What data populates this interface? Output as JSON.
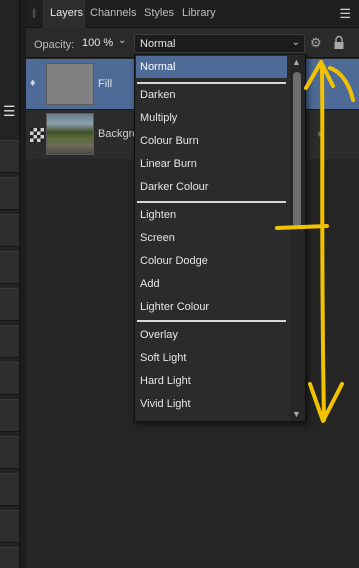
{
  "tabs": [
    {
      "label": "Layers"
    },
    {
      "label": "Channels"
    },
    {
      "label": "Styles"
    },
    {
      "label": "Library"
    }
  ],
  "toolbar": {
    "opacity_label": "Opacity:",
    "opacity_value": "100 %",
    "blend_mode": "Normal"
  },
  "layers": [
    {
      "name": "Fill",
      "selected": true
    },
    {
      "name": "Backgro",
      "selected": false
    }
  ],
  "blend_modes": {
    "group1": [
      "Normal"
    ],
    "group2": [
      "Darken",
      "Multiply",
      "Colour Burn",
      "Linear Burn",
      "Darker Colour"
    ],
    "group3": [
      "Lighten",
      "Screen",
      "Colour Dodge",
      "Add",
      "Lighter Colour"
    ],
    "group4": [
      "Overlay",
      "Soft Light",
      "Hard Light",
      "Vivid Light"
    ],
    "selected": "Normal"
  },
  "colors": {
    "selection": "#4d6b96",
    "annotation": "#f2c200"
  },
  "icons": {
    "panel_grip": "grip-icon",
    "panel_menu": "hamburger-menu-icon",
    "settings": "gear-icon",
    "lock": "lock-icon",
    "fill_layer": "fill-bucket-icon",
    "pixel_layer": "checkerboard-icon",
    "scroll_up": "triangle-up-icon",
    "scroll_down": "triangle-down-icon"
  }
}
